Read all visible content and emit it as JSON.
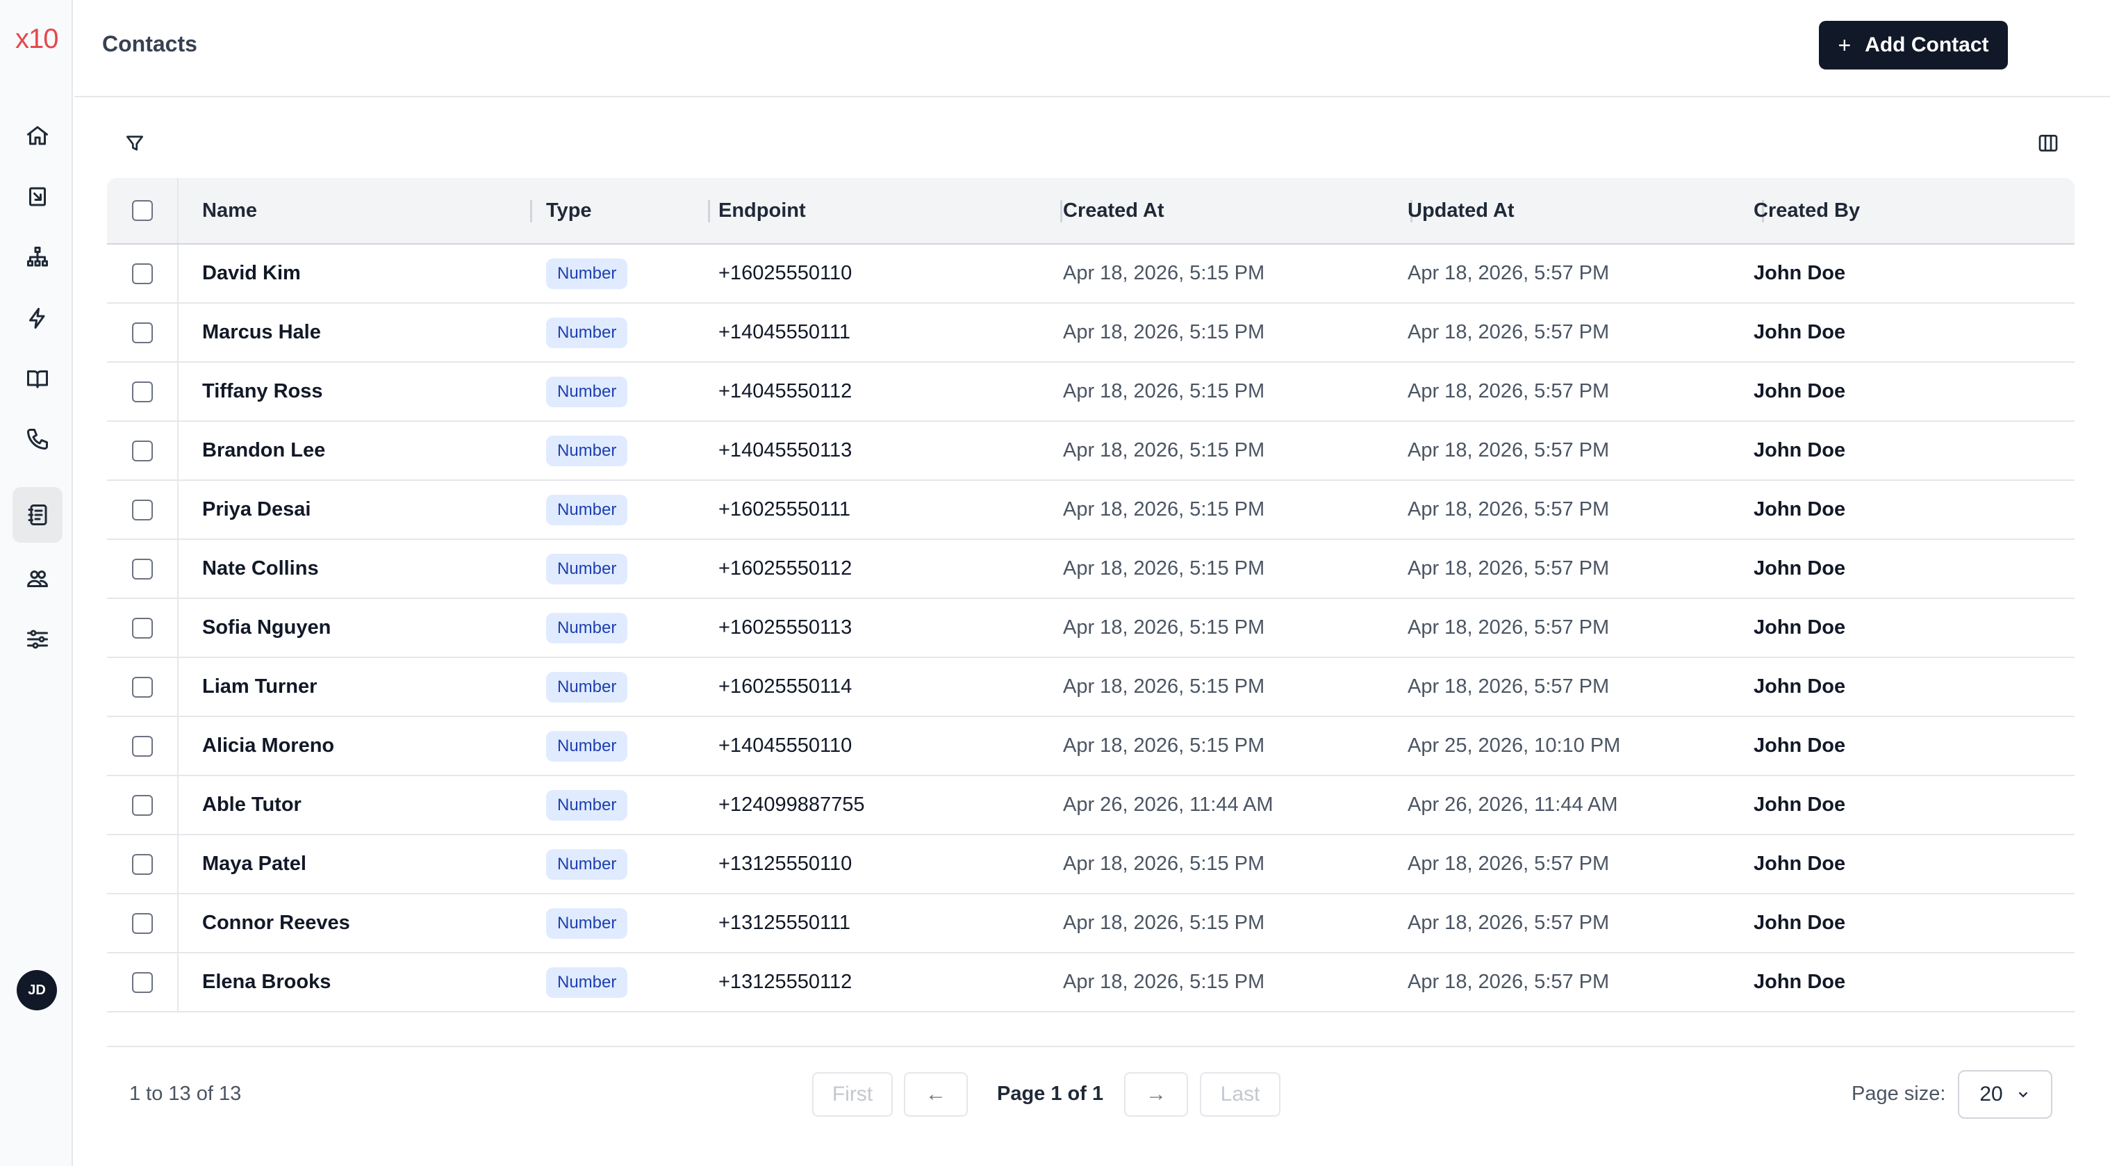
{
  "app": {
    "logo": "x10"
  },
  "sidebar": {
    "items": [
      {
        "icon": "home-icon",
        "label": "Home"
      },
      {
        "icon": "inbox-icon",
        "label": "Inbox"
      },
      {
        "icon": "hierarchy-icon",
        "label": "Workflows"
      },
      {
        "icon": "lightning-icon",
        "label": "Actions"
      },
      {
        "icon": "book-icon",
        "label": "Knowledge"
      },
      {
        "icon": "phone-icon",
        "label": "Calls"
      },
      {
        "icon": "contacts-icon",
        "label": "Contacts",
        "active": true
      },
      {
        "icon": "users-icon",
        "label": "Team"
      },
      {
        "icon": "sliders-icon",
        "label": "Settings"
      }
    ],
    "avatar_initials": "JD"
  },
  "header": {
    "title": "Contacts",
    "add_button_icon": "+",
    "add_button_label": "Add Contact"
  },
  "table": {
    "columns": [
      "Name",
      "Type",
      "Endpoint",
      "Created At",
      "Updated At",
      "Created By"
    ],
    "rows": [
      {
        "name": "David Kim",
        "type": "Number",
        "endpoint": "+16025550110",
        "created": "Apr 18, 2026, 5:15 PM",
        "updated": "Apr 18, 2026, 5:57 PM",
        "by": "John Doe"
      },
      {
        "name": "Marcus Hale",
        "type": "Number",
        "endpoint": "+14045550111",
        "created": "Apr 18, 2026, 5:15 PM",
        "updated": "Apr 18, 2026, 5:57 PM",
        "by": "John Doe"
      },
      {
        "name": "Tiffany Ross",
        "type": "Number",
        "endpoint": "+14045550112",
        "created": "Apr 18, 2026, 5:15 PM",
        "updated": "Apr 18, 2026, 5:57 PM",
        "by": "John Doe"
      },
      {
        "name": "Brandon Lee",
        "type": "Number",
        "endpoint": "+14045550113",
        "created": "Apr 18, 2026, 5:15 PM",
        "updated": "Apr 18, 2026, 5:57 PM",
        "by": "John Doe"
      },
      {
        "name": "Priya Desai",
        "type": "Number",
        "endpoint": "+16025550111",
        "created": "Apr 18, 2026, 5:15 PM",
        "updated": "Apr 18, 2026, 5:57 PM",
        "by": "John Doe"
      },
      {
        "name": "Nate Collins",
        "type": "Number",
        "endpoint": "+16025550112",
        "created": "Apr 18, 2026, 5:15 PM",
        "updated": "Apr 18, 2026, 5:57 PM",
        "by": "John Doe"
      },
      {
        "name": "Sofia Nguyen",
        "type": "Number",
        "endpoint": "+16025550113",
        "created": "Apr 18, 2026, 5:15 PM",
        "updated": "Apr 18, 2026, 5:57 PM",
        "by": "John Doe"
      },
      {
        "name": "Liam Turner",
        "type": "Number",
        "endpoint": "+16025550114",
        "created": "Apr 18, 2026, 5:15 PM",
        "updated": "Apr 18, 2026, 5:57 PM",
        "by": "John Doe"
      },
      {
        "name": "Alicia Moreno",
        "type": "Number",
        "endpoint": "+14045550110",
        "created": "Apr 18, 2026, 5:15 PM",
        "updated": "Apr 25, 2026, 10:10 PM",
        "by": "John Doe"
      },
      {
        "name": "Able Tutor",
        "type": "Number",
        "endpoint": "+124099887755",
        "created": "Apr 26, 2026, 11:44 AM",
        "updated": "Apr 26, 2026, 11:44 AM",
        "by": "John Doe"
      },
      {
        "name": "Maya Patel",
        "type": "Number",
        "endpoint": "+13125550110",
        "created": "Apr 18, 2026, 5:15 PM",
        "updated": "Apr 18, 2026, 5:57 PM",
        "by": "John Doe"
      },
      {
        "name": "Connor Reeves",
        "type": "Number",
        "endpoint": "+13125550111",
        "created": "Apr 18, 2026, 5:15 PM",
        "updated": "Apr 18, 2026, 5:57 PM",
        "by": "John Doe"
      },
      {
        "name": "Elena Brooks",
        "type": "Number",
        "endpoint": "+13125550112",
        "created": "Apr 18, 2026, 5:15 PM",
        "updated": "Apr 18, 2026, 5:57 PM",
        "by": "John Doe"
      }
    ]
  },
  "pagination": {
    "range": "1 to 13 of 13",
    "first": "First",
    "prev_icon": "←",
    "page": "Page 1 of 1",
    "next_icon": "→",
    "last": "Last",
    "page_size_label": "Page size:",
    "page_size": "20"
  },
  "colors": {
    "logo": "#e5484d",
    "primary_button": "#111827",
    "badge_bg": "#e0ebff",
    "badge_text": "#1e40af"
  }
}
